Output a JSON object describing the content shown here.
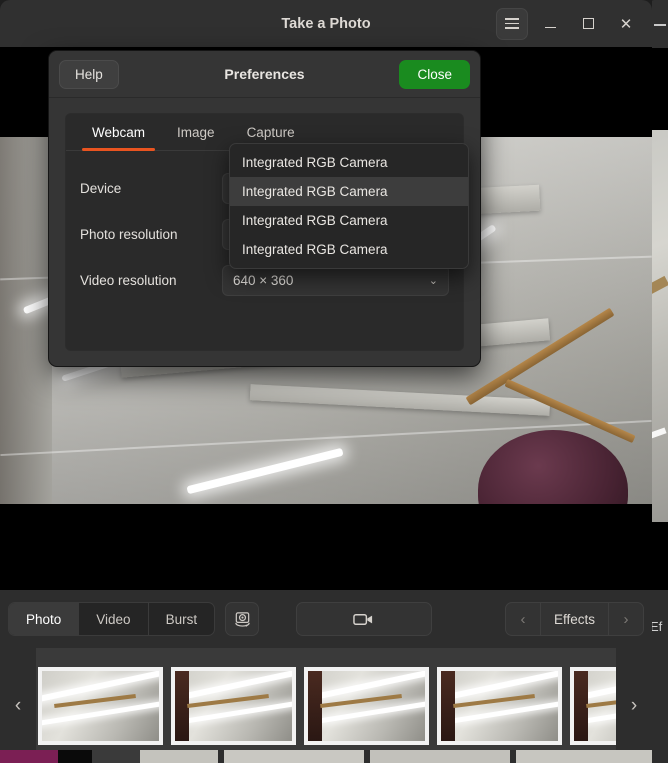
{
  "window": {
    "title": "Take a Photo",
    "controls": {
      "menu": "menu-icon",
      "minimize": "–",
      "maximize": "□",
      "close": "✕"
    }
  },
  "preferences": {
    "title": "Preferences",
    "help_label": "Help",
    "close_label": "Close",
    "accent_color": "#E95420",
    "close_button_color": "#1a8b1f",
    "tabs": [
      {
        "label": "Webcam",
        "active": true
      },
      {
        "label": "Image",
        "active": false
      },
      {
        "label": "Capture",
        "active": false
      }
    ],
    "rows": [
      {
        "label": "Device",
        "value": "Integrated RGB Camera"
      },
      {
        "label": "Photo resolution",
        "value": ""
      },
      {
        "label": "Video resolution",
        "value": "640 × 360"
      }
    ],
    "device_dropdown": {
      "open": true,
      "options": [
        {
          "label": "Integrated RGB Camera",
          "highlighted": false
        },
        {
          "label": "Integrated RGB Camera",
          "highlighted": true
        },
        {
          "label": "Integrated RGB Camera",
          "highlighted": false
        },
        {
          "label": "Integrated RGB Camera",
          "highlighted": false
        }
      ]
    },
    "chevron": "⌄"
  },
  "toolbar": {
    "modes": [
      {
        "label": "Photo",
        "active": true
      },
      {
        "label": "Video",
        "active": false
      },
      {
        "label": "Burst",
        "active": false
      }
    ],
    "camera_switch_icon": "camera-switch-icon",
    "record_icon": "camcorder-icon",
    "effects_label": "Effects",
    "prev_arrow": "‹",
    "next_arrow": "›"
  },
  "gallery": {
    "prev_arrow": "‹",
    "next_arrow": "›",
    "thumbnails": [
      {
        "name": "thumbnail-1"
      },
      {
        "name": "thumbnail-2"
      },
      {
        "name": "thumbnail-3"
      },
      {
        "name": "thumbnail-4"
      },
      {
        "name": "thumbnail-5"
      }
    ]
  },
  "background_window": {
    "effects_label": "Ef"
  }
}
